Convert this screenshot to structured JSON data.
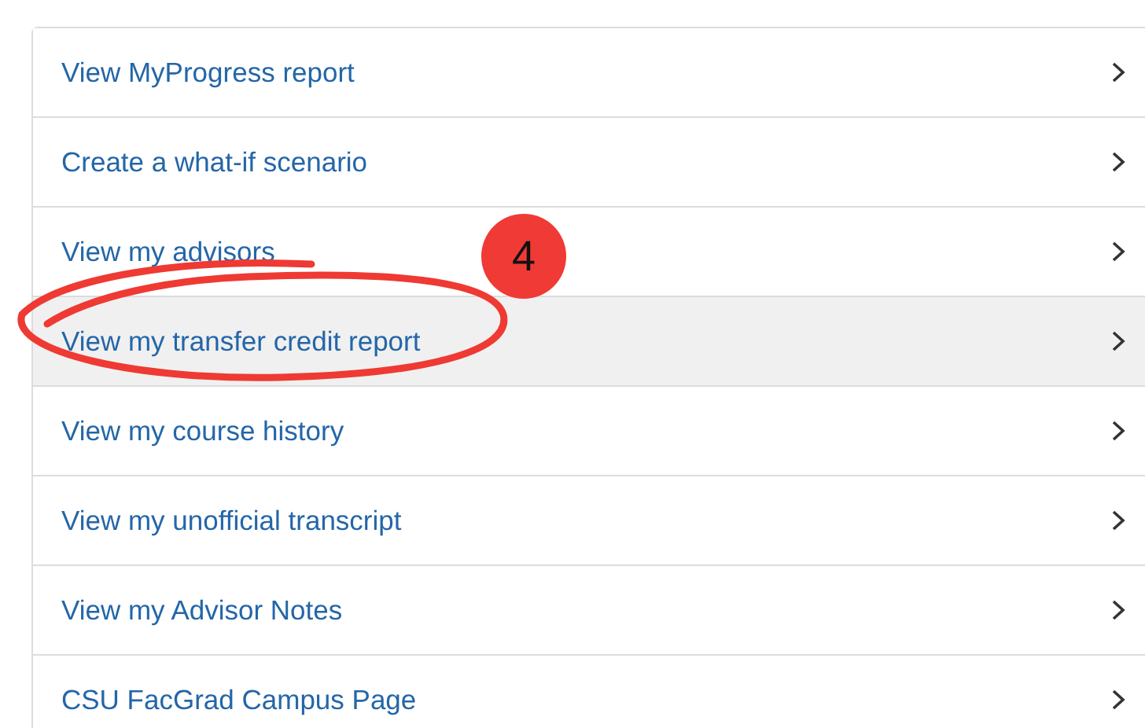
{
  "menu": [
    {
      "label": "View MyProgress report",
      "selected": false
    },
    {
      "label": "Create a what-if scenario",
      "selected": false
    },
    {
      "label": "View my advisors",
      "selected": false
    },
    {
      "label": "View my transfer credit report",
      "selected": true
    },
    {
      "label": "View my course history",
      "selected": false
    },
    {
      "label": "View my unofficial transcript",
      "selected": false
    },
    {
      "label": "View my Advisor Notes",
      "selected": false
    },
    {
      "label": "CSU FacGrad Campus Page",
      "selected": false
    }
  ],
  "annotation": {
    "number": "4"
  }
}
